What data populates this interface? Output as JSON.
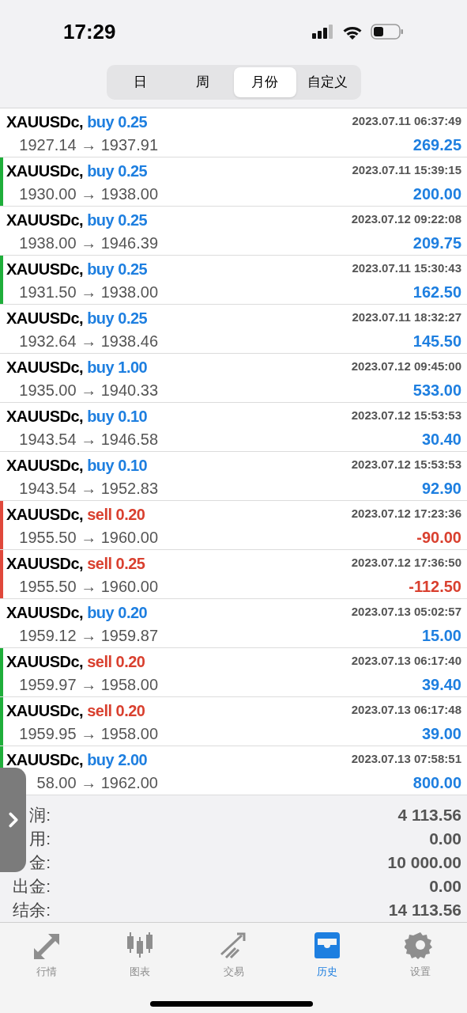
{
  "status_bar": {
    "time": "17:29"
  },
  "period_tabs": [
    {
      "label": "日",
      "selected": false
    },
    {
      "label": "周",
      "selected": false
    },
    {
      "label": "月份",
      "selected": true
    },
    {
      "label": "自定义",
      "selected": false
    }
  ],
  "trades": [
    {
      "symbol": "XAUUSDc,",
      "sell": false,
      "order": "buy 0.25",
      "time": "2023.07.11 06:37:49",
      "prices": "1927.14 → 1937.91",
      "profit": "269.25",
      "loss": false
    },
    {
      "symbol": "XAUUSDc,",
      "sell": false,
      "order": "buy 0.25",
      "time": "2023.07.11 15:39:15",
      "prices": "1930.00 → 1938.00",
      "profit": "200.00",
      "loss": false,
      "color": "#1fae3a"
    },
    {
      "symbol": "XAUUSDc,",
      "sell": false,
      "order": "buy 0.25",
      "time": "2023.07.12 09:22:08",
      "prices": "1938.00 → 1946.39",
      "profit": "209.75",
      "loss": false
    },
    {
      "symbol": "XAUUSDc,",
      "sell": false,
      "order": "buy 0.25",
      "time": "2023.07.11 15:30:43",
      "prices": "1931.50 → 1938.00",
      "profit": "162.50",
      "loss": false,
      "color": "#1fae3a"
    },
    {
      "symbol": "XAUUSDc,",
      "sell": false,
      "order": "buy 0.25",
      "time": "2023.07.11 18:32:27",
      "prices": "1932.64 → 1938.46",
      "profit": "145.50",
      "loss": false
    },
    {
      "symbol": "XAUUSDc,",
      "sell": false,
      "order": "buy 1.00",
      "time": "2023.07.12 09:45:00",
      "prices": "1935.00 → 1940.33",
      "profit": "533.00",
      "loss": false
    },
    {
      "symbol": "XAUUSDc,",
      "sell": false,
      "order": "buy 0.10",
      "time": "2023.07.12 15:53:53",
      "prices": "1943.54 → 1946.58",
      "profit": "30.40",
      "loss": false
    },
    {
      "symbol": "XAUUSDc,",
      "sell": false,
      "order": "buy 0.10",
      "time": "2023.07.12 15:53:53",
      "prices": "1943.54 → 1952.83",
      "profit": "92.90",
      "loss": false
    },
    {
      "symbol": "XAUUSDc,",
      "sell": true,
      "order": "sell 0.20",
      "time": "2023.07.12 17:23:36",
      "prices": "1955.50 → 1960.00",
      "profit": "-90.00",
      "loss": true,
      "color": "#e0483b"
    },
    {
      "symbol": "XAUUSDc,",
      "sell": true,
      "order": "sell 0.25",
      "time": "2023.07.12 17:36:50",
      "prices": "1955.50 → 1960.00",
      "profit": "-112.50",
      "loss": true,
      "color": "#e0483b"
    },
    {
      "symbol": "XAUUSDc,",
      "sell": false,
      "order": "buy 0.20",
      "time": "2023.07.13 05:02:57",
      "prices": "1959.12 → 1959.87",
      "profit": "15.00",
      "loss": false
    },
    {
      "symbol": "XAUUSDc,",
      "sell": true,
      "order": "sell 0.20",
      "time": "2023.07.13 06:17:40",
      "prices": "1959.97 → 1958.00",
      "profit": "39.40",
      "loss": false,
      "color": "#1fae3a"
    },
    {
      "symbol": "XAUUSDc,",
      "sell": true,
      "order": "sell 0.20",
      "time": "2023.07.13 06:17:48",
      "prices": "1959.95 → 1958.00",
      "profit": "39.00",
      "loss": false,
      "color": "#1fae3a"
    },
    {
      "symbol": "XAUUSDc,",
      "sell": false,
      "order": "buy 2.00",
      "time": "2023.07.13 07:58:51",
      "prices": "58.00 → 1962.00",
      "profit": "800.00",
      "loss": false,
      "color": "#1fae3a"
    }
  ],
  "summary": [
    {
      "label": "润:",
      "value": "4 113.56"
    },
    {
      "label": "用:",
      "value": "0.00"
    },
    {
      "label": "金:",
      "value": "10 000.00"
    },
    {
      "label": "出金:",
      "value": "0.00"
    },
    {
      "label": "结余:",
      "value": "14 113.56"
    }
  ],
  "tab_bar": [
    {
      "kind": "quotes",
      "label": "行情",
      "selected": false
    },
    {
      "kind": "chart",
      "label": "图表",
      "selected": false
    },
    {
      "kind": "trade",
      "label": "交易",
      "selected": false
    },
    {
      "kind": "history",
      "label": "历史",
      "selected": true
    },
    {
      "kind": "settings",
      "label": "设置",
      "selected": false
    }
  ]
}
